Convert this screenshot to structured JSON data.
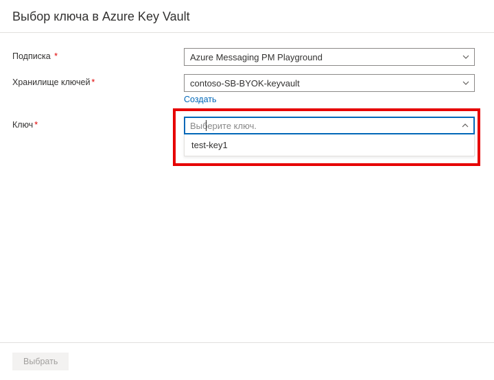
{
  "header": {
    "title": "Выбор ключа в Azure Key Vault"
  },
  "form": {
    "subscription": {
      "label": "Подписка",
      "value": "Azure Messaging PM Playground"
    },
    "vault": {
      "label": "Хранилище ключей",
      "value": "contoso-SB-BYOK-keyvault",
      "create_link": "Создать"
    },
    "key": {
      "label": "Ключ",
      "placeholder": "Выберите ключ.",
      "options": [
        "test-key1"
      ]
    }
  },
  "footer": {
    "select_button": "Выбрать"
  }
}
